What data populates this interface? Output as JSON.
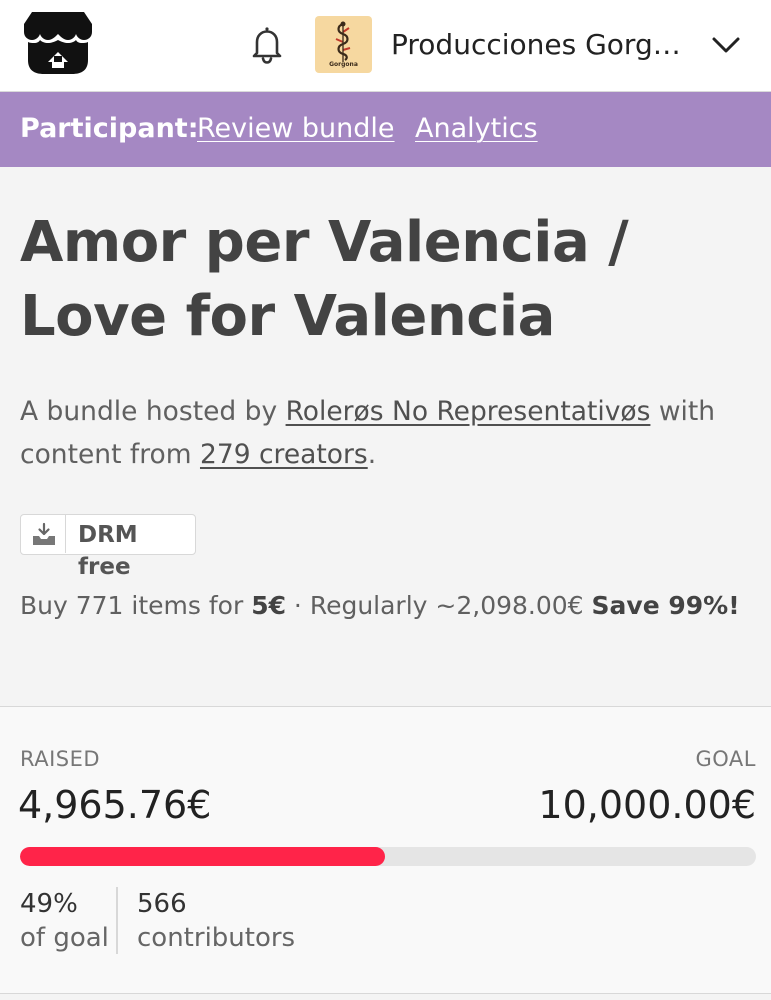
{
  "header": {
    "logo_icon": "itch-io-logo-icon",
    "notifications_icon": "bell-icon",
    "user_avatar_text": "Gorgona",
    "user_name": "Producciones Gorgona",
    "menu_icon": "chevron-down-icon"
  },
  "participant_bar": {
    "label": "Participant:",
    "review_link": "Review bundle",
    "analytics_link": "Analytics",
    "background": "#a588c3"
  },
  "bundle": {
    "title": "Amor per Valencia / Love for Valencia",
    "desc_prefix": "A bundle hosted by ",
    "host": "Rolerøs No Representativøs",
    "desc_middle": " with content from ",
    "creators": "279 creators",
    "desc_suffix": ".",
    "drm_icon": "download-icon",
    "drm_label": "DRM free",
    "price_prefix": "Buy 771 items for ",
    "price": "5€",
    "price_middle": " · Regularly ~2,098.00€ ",
    "savings": "Save 99%!"
  },
  "fundraising": {
    "raised_label": "RAISED",
    "raised_value": "4,965.76€",
    "goal_label": "GOAL",
    "goal_value": "10,000.00€",
    "progress_fraction": 0.4966,
    "progress_color": "#ff2449",
    "percent_value": "49%",
    "percent_label": "of goal",
    "contributors_value": "566",
    "contributors_label": "contributors"
  }
}
